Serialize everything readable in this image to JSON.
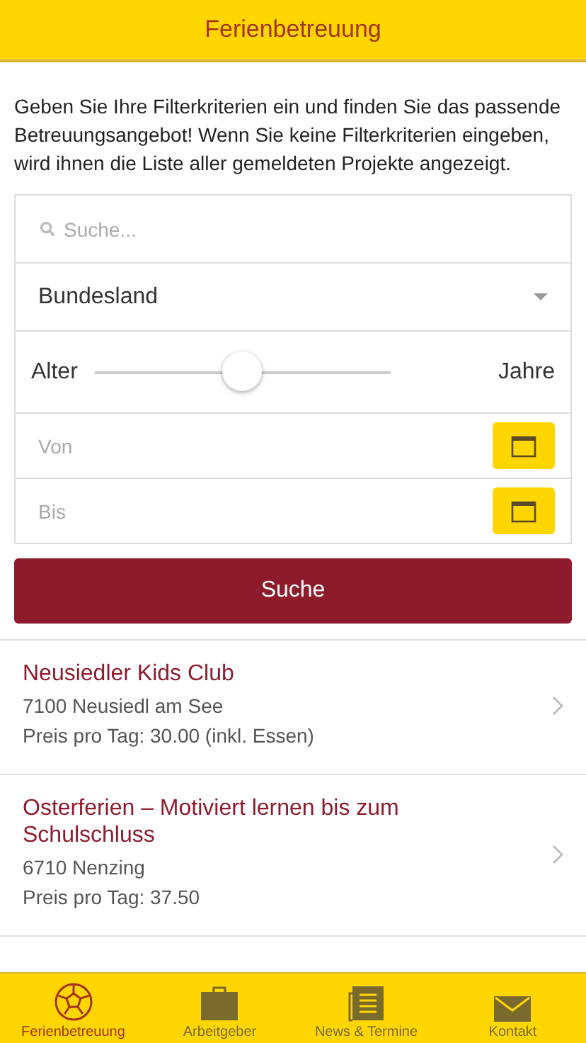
{
  "header": {
    "title": "Ferienbetreuung"
  },
  "intro": "Geben Sie Ihre Filterkriterien ein und finden Sie das passende Betreuungsangebot! Wenn Sie keine Filterkriterien eingeben, wird ihnen die Liste aller gemeldeten Projekte angezeigt.",
  "filters": {
    "search": {
      "placeholder": "Suche..."
    },
    "state_select": {
      "value": "Bundesland"
    },
    "age": {
      "label": "Alter",
      "unit": "Jahre",
      "level": 0.5
    },
    "from": {
      "placeholder": "Von"
    },
    "to": {
      "placeholder": "Bis"
    }
  },
  "search_button": "Suche",
  "results": [
    {
      "title": "Neusiedler Kids Club",
      "location": "7100 Neusiedl am See",
      "price": "Preis pro Tag: 30.00 (inkl. Essen)"
    },
    {
      "title": "Osterferien – Motiviert lernen bis zum Schulschluss",
      "location": "6710 Nenzing",
      "price": "Preis pro Tag: 37.50"
    }
  ],
  "tabs": [
    {
      "label": "Ferienbetreuung",
      "selected": true
    },
    {
      "label": "Arbeitgeber",
      "selected": false
    },
    {
      "label": "News & Termine",
      "selected": false
    },
    {
      "label": "Kontakt",
      "selected": false
    }
  ]
}
